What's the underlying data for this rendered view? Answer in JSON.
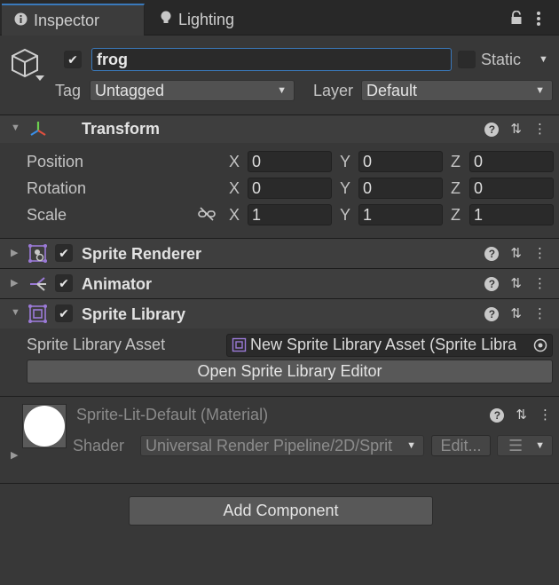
{
  "tabs": [
    {
      "label": "Inspector",
      "icon": "info-icon"
    },
    {
      "label": "Lighting",
      "icon": "lightbulb-icon"
    }
  ],
  "gameobject": {
    "active": true,
    "name": "frog",
    "static_label": "Static",
    "static_checked": false,
    "tag_label": "Tag",
    "tag_value": "Untagged",
    "layer_label": "Layer",
    "layer_value": "Default"
  },
  "transform": {
    "title": "Transform",
    "rows": [
      {
        "label": "Position",
        "x": "0",
        "y": "0",
        "z": "0"
      },
      {
        "label": "Rotation",
        "x": "0",
        "y": "0",
        "z": "0"
      },
      {
        "label": "Scale",
        "x": "1",
        "y": "1",
        "z": "1"
      }
    ],
    "axis": {
      "x": "X",
      "y": "Y",
      "z": "Z"
    }
  },
  "sprite_renderer": {
    "title": "Sprite Renderer",
    "enabled": true
  },
  "animator": {
    "title": "Animator",
    "enabled": true
  },
  "sprite_library": {
    "title": "Sprite Library",
    "enabled": true,
    "asset_label": "Sprite Library Asset",
    "asset_value": "New Sprite Library Asset (Sprite Libra",
    "open_editor_label": "Open Sprite Library Editor"
  },
  "material": {
    "title": "Sprite-Lit-Default (Material)",
    "shader_label": "Shader",
    "shader_value": "Universal Render Pipeline/2D/Sprit",
    "edit_label": "Edit..."
  },
  "add_component_label": "Add Component",
  "colors": {
    "accent": "#3a79bb",
    "panel": "#383838",
    "header": "#3e3e3e",
    "field": "#2a2a2a"
  }
}
